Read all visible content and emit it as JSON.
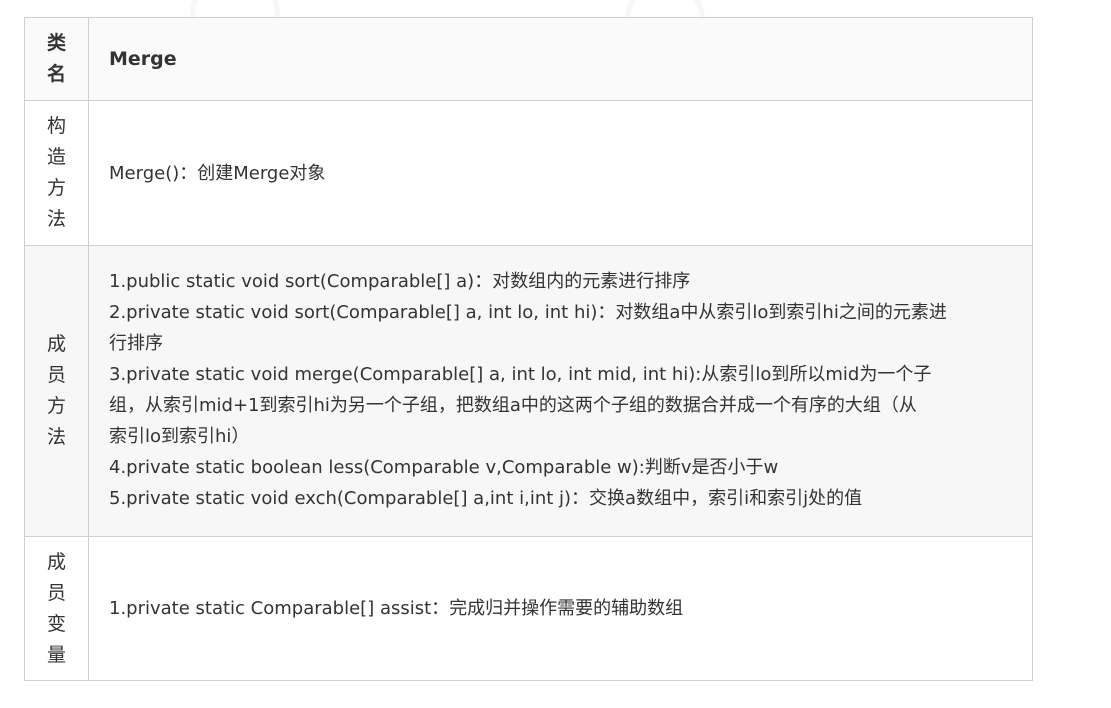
{
  "table": {
    "header": {
      "label_chars": [
        "类",
        "名"
      ],
      "value": "Merge"
    },
    "constructor": {
      "label_chars": [
        "构",
        "造",
        "方",
        "法"
      ],
      "value": "Merge()：创建Merge对象"
    },
    "methods": {
      "label_chars": [
        "成",
        "员",
        "方",
        "法"
      ],
      "lines": [
        "1.public static void sort(Comparable[] a)：对数组内的元素进行排序",
        "2.private static void sort(Comparable[] a, int lo, int hi)：对数组a中从索引lo到索引hi之间的元素进",
        "行排序",
        "3.private static void merge(Comparable[] a, int lo, int mid, int hi):从索引lo到所以mid为一个子",
        "组，从索引mid+1到索引hi为另一个子组，把数组a中的这两个子组的数据合并成一个有序的大组（从",
        "索引lo到索引hi）",
        "4.private static boolean less(Comparable v,Comparable w):判断v是否小于w",
        "5.private static void exch(Comparable[] a,int i,int j)：交换a数组中，索引i和索引j处的值"
      ]
    },
    "fields": {
      "label_chars": [
        "成",
        "员",
        "变",
        "量"
      ],
      "value": "1.private static Comparable[] assist：完成归并操作需要的辅助数组"
    }
  }
}
